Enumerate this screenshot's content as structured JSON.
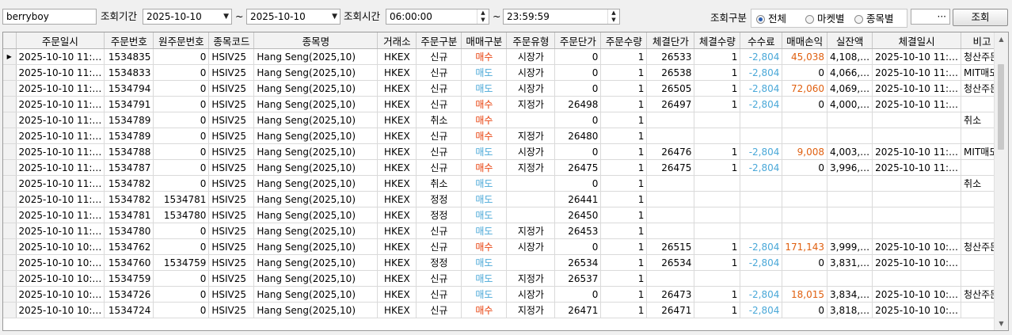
{
  "toolbar": {
    "account": "berryboy",
    "period_label": "조회기간",
    "date_from": "2025-10-10",
    "tilde1": "~",
    "date_to": "2025-10-10",
    "time_label": "조회시간",
    "time_from": "06:00:00",
    "tilde2": "~",
    "time_to": "23:59:59",
    "type_label": "조회구분",
    "radio_all": "전체",
    "radio_market": "마켓별",
    "radio_symbol": "종목별",
    "ellipsis": "···",
    "search_button": "조회",
    "selected_radio": "전체"
  },
  "colors": {
    "buy": "#e8400c",
    "sell": "#4aa8d8",
    "fee": "#4aa8d8",
    "pnl": "#e06010"
  },
  "columns": [
    "주문일시",
    "주문번호",
    "원주문번호",
    "종목코드",
    "종목명",
    "거래소",
    "주문구분",
    "매매구분",
    "주문유형",
    "주문단가",
    "주문수량",
    "체결단가",
    "체결수량",
    "수수료",
    "매매손익",
    "실잔액",
    "체결일시",
    "비고"
  ],
  "rows": [
    [
      "2025-10-10 11:…",
      "1534835",
      "0",
      "HSIV25",
      "Hang Seng(2025,10)",
      "HKEX",
      "신규",
      "매수",
      "시장가",
      "0",
      "1",
      "26533",
      "1",
      "-2,804",
      "45,038",
      "4,108,…",
      "2025-10-10 11:…",
      "청산주문"
    ],
    [
      "2025-10-10 11:…",
      "1534833",
      "0",
      "HSIV25",
      "Hang Seng(2025,10)",
      "HKEX",
      "신규",
      "매도",
      "시장가",
      "0",
      "1",
      "26538",
      "1",
      "-2,804",
      "0",
      "4,066,…",
      "2025-10-10 11:…",
      "MIT매도"
    ],
    [
      "2025-10-10 11:…",
      "1534794",
      "0",
      "HSIV25",
      "Hang Seng(2025,10)",
      "HKEX",
      "신규",
      "매도",
      "시장가",
      "0",
      "1",
      "26505",
      "1",
      "-2,804",
      "72,060",
      "4,069,…",
      "2025-10-10 11:…",
      "청산주문"
    ],
    [
      "2025-10-10 11:…",
      "1534791",
      "0",
      "HSIV25",
      "Hang Seng(2025,10)",
      "HKEX",
      "신규",
      "매수",
      "지정가",
      "26498",
      "1",
      "26497",
      "1",
      "-2,804",
      "0",
      "4,000,…",
      "2025-10-10 11:…",
      ""
    ],
    [
      "2025-10-10 11:…",
      "1534789",
      "0",
      "HSIV25",
      "Hang Seng(2025,10)",
      "HKEX",
      "취소",
      "매수",
      "",
      "0",
      "1",
      "",
      "",
      "",
      "",
      "",
      "",
      "취소"
    ],
    [
      "2025-10-10 11:…",
      "1534789",
      "0",
      "HSIV25",
      "Hang Seng(2025,10)",
      "HKEX",
      "신규",
      "매수",
      "지정가",
      "26480",
      "1",
      "",
      "",
      "",
      "",
      "",
      "",
      ""
    ],
    [
      "2025-10-10 11:…",
      "1534788",
      "0",
      "HSIV25",
      "Hang Seng(2025,10)",
      "HKEX",
      "신규",
      "매도",
      "시장가",
      "0",
      "1",
      "26476",
      "1",
      "-2,804",
      "9,008",
      "4,003,…",
      "2025-10-10 11:…",
      "MIT매도"
    ],
    [
      "2025-10-10 11:…",
      "1534787",
      "0",
      "HSIV25",
      "Hang Seng(2025,10)",
      "HKEX",
      "신규",
      "매수",
      "지정가",
      "26475",
      "1",
      "26475",
      "1",
      "-2,804",
      "0",
      "3,996,…",
      "2025-10-10 11:…",
      ""
    ],
    [
      "2025-10-10 11:…",
      "1534782",
      "0",
      "HSIV25",
      "Hang Seng(2025,10)",
      "HKEX",
      "취소",
      "매도",
      "",
      "0",
      "1",
      "",
      "",
      "",
      "",
      "",
      "",
      "취소"
    ],
    [
      "2025-10-10 11:…",
      "1534782",
      "1534781",
      "HSIV25",
      "Hang Seng(2025,10)",
      "HKEX",
      "정정",
      "매도",
      "",
      "26441",
      "1",
      "",
      "",
      "",
      "",
      "",
      "",
      ""
    ],
    [
      "2025-10-10 11:…",
      "1534781",
      "1534780",
      "HSIV25",
      "Hang Seng(2025,10)",
      "HKEX",
      "정정",
      "매도",
      "",
      "26450",
      "1",
      "",
      "",
      "",
      "",
      "",
      "",
      ""
    ],
    [
      "2025-10-10 11:…",
      "1534780",
      "0",
      "HSIV25",
      "Hang Seng(2025,10)",
      "HKEX",
      "신규",
      "매도",
      "지정가",
      "26453",
      "1",
      "",
      "",
      "",
      "",
      "",
      "",
      ""
    ],
    [
      "2025-10-10 10:…",
      "1534762",
      "0",
      "HSIV25",
      "Hang Seng(2025,10)",
      "HKEX",
      "신규",
      "매수",
      "시장가",
      "0",
      "1",
      "26515",
      "1",
      "-2,804",
      "171,143",
      "3,999,…",
      "2025-10-10 10:…",
      "청산주문"
    ],
    [
      "2025-10-10 10:…",
      "1534760",
      "1534759",
      "HSIV25",
      "Hang Seng(2025,10)",
      "HKEX",
      "정정",
      "매도",
      "",
      "26534",
      "1",
      "26534",
      "1",
      "-2,804",
      "0",
      "3,831,…",
      "2025-10-10 10:…",
      ""
    ],
    [
      "2025-10-10 10:…",
      "1534759",
      "0",
      "HSIV25",
      "Hang Seng(2025,10)",
      "HKEX",
      "신규",
      "매도",
      "지정가",
      "26537",
      "1",
      "",
      "",
      "",
      "",
      "",
      "",
      ""
    ],
    [
      "2025-10-10 10:…",
      "1534726",
      "0",
      "HSIV25",
      "Hang Seng(2025,10)",
      "HKEX",
      "신규",
      "매도",
      "시장가",
      "0",
      "1",
      "26473",
      "1",
      "-2,804",
      "18,015",
      "3,834,…",
      "2025-10-10 10:…",
      "청산주문"
    ],
    [
      "2025-10-10 10:…",
      "1534724",
      "0",
      "HSIV25",
      "Hang Seng(2025,10)",
      "HKEX",
      "신규",
      "매수",
      "지정가",
      "26471",
      "1",
      "26471",
      "1",
      "-2,804",
      "0",
      "3,818,…",
      "2025-10-10 10:…",
      ""
    ]
  ]
}
